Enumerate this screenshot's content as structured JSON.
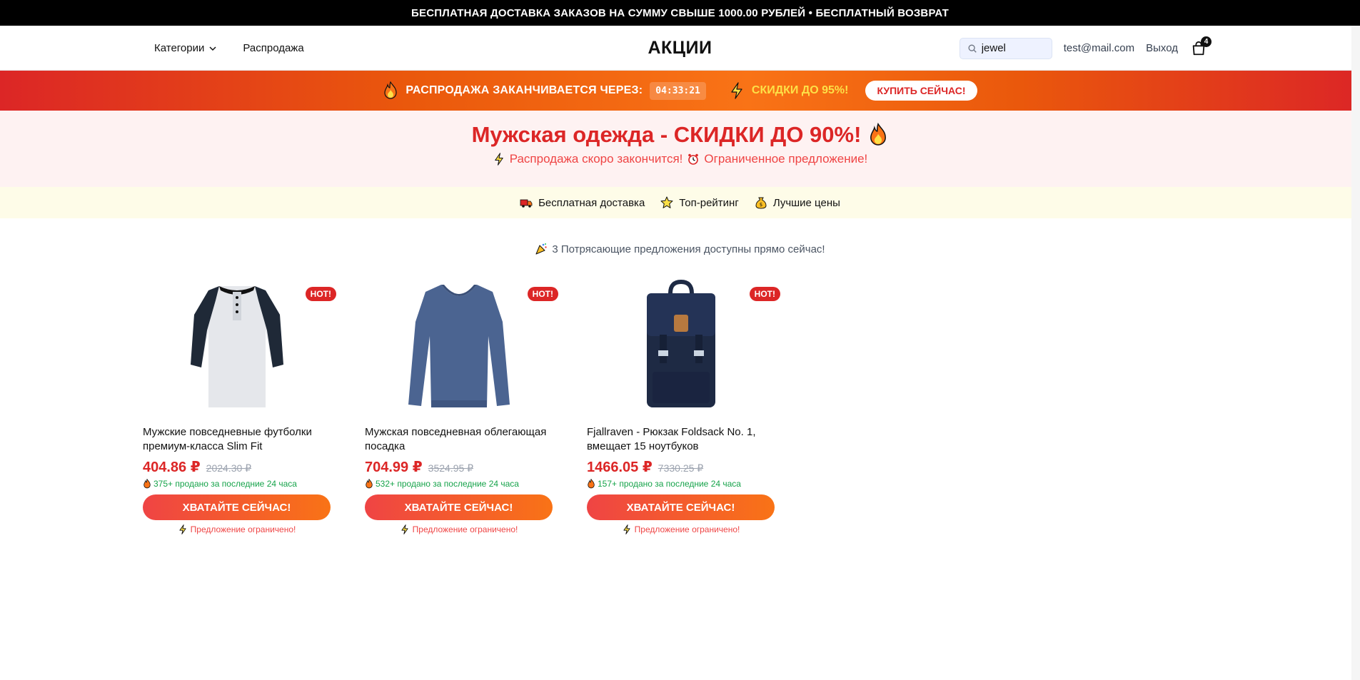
{
  "topbar": {
    "text": "БЕСПЛАТНАЯ ДОСТАВКА ЗАКАЗОВ НА СУММУ СВЫШЕ 1000.00 РУБЛЕЙ • БЕСПЛАТНЫЙ ВОЗВРАТ"
  },
  "nav": {
    "categories_label": "Категории",
    "sale_label": "Распродажа",
    "brand": "АКЦИИ",
    "search_value": "jewel",
    "email": "test@mail.com",
    "logout_label": "Выход",
    "cart_count": "4"
  },
  "sale_banner": {
    "ends_label": "РАСПРОДАЖА ЗАКАНЧИВАЕТСЯ ЧЕРЕЗ:",
    "timer": "04:33:21",
    "discount_text": "СКИДКИ ДО 95%!",
    "buy_label": "КУПИТЬ СЕЙЧАС!"
  },
  "hero": {
    "title": "Мужская одежда - СКИДКИ ДО 90%!",
    "subtitle_part1": "Распродажа скоро закончится!",
    "subtitle_part2": "Ограниченное предложение!"
  },
  "features": [
    {
      "label": "Бесплатная доставка",
      "icon": "truck-icon"
    },
    {
      "label": "Топ-рейтинг",
      "icon": "star-icon"
    },
    {
      "label": "Лучшие цены",
      "icon": "money-bag-icon"
    }
  ],
  "offers_note": "3 Потрясающие предложения доступны прямо сейчас!",
  "products": [
    {
      "badge": "HOT!",
      "title": "Мужские повседневные футболки премиум-класса Slim Fit",
      "price": "404.86 ₽",
      "old_price": "2024.30 ₽",
      "sold": "375+ продано за последние 24 часа",
      "cta": "ХВАТАЙТЕ СЕЙЧАС!",
      "limited": "Предложение ограничено!"
    },
    {
      "badge": "HOT!",
      "title": "Мужская повседневная облегающая посадка",
      "price": "704.99 ₽",
      "old_price": "3524.95 ₽",
      "sold": "532+ продано за последние 24 часа",
      "cta": "ХВАТАЙТЕ СЕЙЧАС!",
      "limited": "Предложение ограничено!"
    },
    {
      "badge": "HOT!",
      "title": "Fjallraven - Рюкзак Foldsack No. 1, вмещает 15 ноутбуков",
      "price": "1466.05 ₽",
      "old_price": "7330.25 ₽",
      "sold": "157+ продано за последние 24 часа",
      "cta": "ХВАТАЙТЕ СЕЙЧАС!",
      "limited": "Предложение ограничено!"
    }
  ],
  "colors": {
    "accent_red": "#dc2626",
    "accent_orange": "#f97316",
    "sold_green": "#16a34a",
    "discount_yellow": "#fde047"
  }
}
